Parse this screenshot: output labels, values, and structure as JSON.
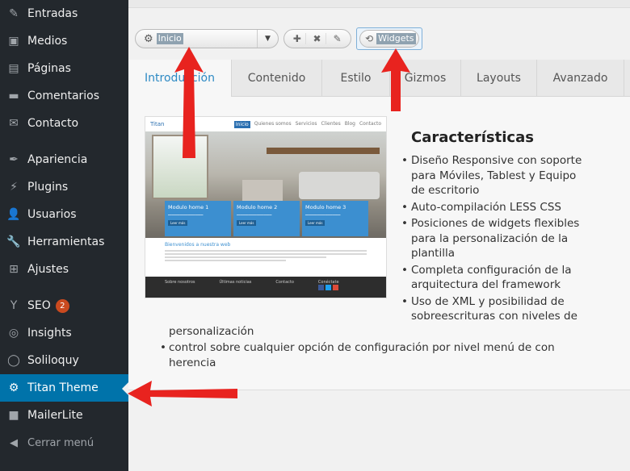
{
  "sidebar": {
    "items": [
      {
        "label": "Entradas",
        "icon": "pin-icon",
        "glyph": "✎"
      },
      {
        "label": "Medios",
        "icon": "media-icon",
        "glyph": "▣"
      },
      {
        "label": "Páginas",
        "icon": "pages-icon",
        "glyph": "▤"
      },
      {
        "label": "Comentarios",
        "icon": "comments-icon",
        "glyph": "▬"
      },
      {
        "label": "Contacto",
        "icon": "mail-icon",
        "glyph": "✉"
      },
      {
        "label": "Apariencia",
        "icon": "appearance-icon",
        "glyph": "✒"
      },
      {
        "label": "Plugins",
        "icon": "plugins-icon",
        "glyph": "⚡"
      },
      {
        "label": "Usuarios",
        "icon": "users-icon",
        "glyph": "👤"
      },
      {
        "label": "Herramientas",
        "icon": "tools-icon",
        "glyph": "🔧"
      },
      {
        "label": "Ajustes",
        "icon": "settings-icon",
        "glyph": "⊞"
      },
      {
        "label": "SEO",
        "icon": "seo-icon",
        "glyph": "Y",
        "badge": "2"
      },
      {
        "label": "Insights",
        "icon": "insights-icon",
        "glyph": "◎"
      },
      {
        "label": "Soliloquy",
        "icon": "soliloquy-icon",
        "glyph": "◯"
      },
      {
        "label": "Titan Theme",
        "icon": "gear-icon",
        "glyph": "⚙",
        "active": true
      },
      {
        "label": "MailerLite",
        "icon": "mailerlite-icon",
        "glyph": "■"
      },
      {
        "label": "Cerrar menú",
        "icon": "collapse-icon",
        "glyph": "◀"
      }
    ],
    "active_color": "#0073aa"
  },
  "toolbar": {
    "select_value": "Inicio",
    "widgets_label": "Widgets"
  },
  "tabs": [
    "Introducción",
    "Contenido",
    "Estilo",
    "Gizmos",
    "Layouts",
    "Avanzado"
  ],
  "active_tab": "Introducción",
  "preview": {
    "logo": "Titan",
    "nav": [
      "Inicio",
      "Quienes somos",
      "Servicios",
      "Clientes",
      "Blog",
      "Contacto"
    ],
    "modules": [
      {
        "title": "Modulo home 1",
        "button": "Leer más"
      },
      {
        "title": "Modulo home 2",
        "button": "Leer más"
      },
      {
        "title": "Modulo home 3",
        "button": "Leer más"
      }
    ],
    "welcome": "Bienvenidos a nuestra web",
    "footer": [
      "Sobre nosotros",
      "Últimas noticias",
      "Contacto",
      "Conéctate"
    ]
  },
  "features": {
    "title": "Características",
    "items": [
      "Diseño Responsive con soporte para Móviles, Tablest y Equipo de escritorio",
      "Auto-compilación LESS CSS",
      "Posiciones de widgets flexibles para la personalización de la plantilla",
      "Completa configuración de la arquitectura del framework",
      "Uso de XML y posibilidad de sobreescrituras con niveles de"
    ],
    "item5_continuation": "personalización",
    "last_item": "control sobre cualquier opción de configuración por nivel menú de con herencia"
  },
  "colors": {
    "annotation_arrow": "#e8231f",
    "tab_active_text": "#2e8ac4"
  }
}
